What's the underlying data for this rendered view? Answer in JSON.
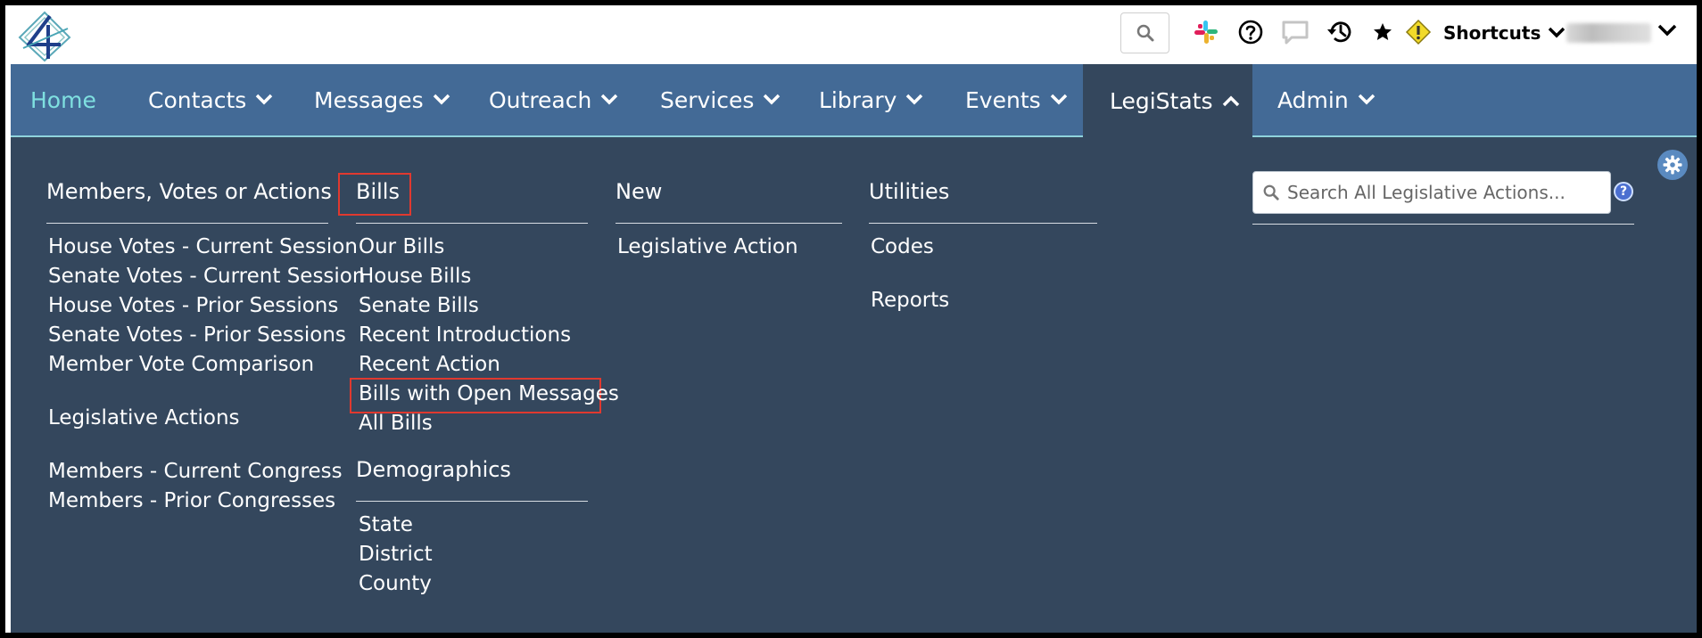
{
  "topbar": {
    "shortcuts_label": "Shortcuts",
    "icons": [
      "search-icon",
      "slack-icon",
      "help-icon",
      "chat-icon",
      "history-icon",
      "star-icon",
      "warning-icon"
    ],
    "colors": {
      "warning": "#e8d21c",
      "slack_red": "#e01e5a",
      "slack_green": "#2eb67d",
      "slack_blue": "#36c5f0",
      "slack_yellow": "#ecb22e"
    }
  },
  "nav": {
    "background": "#436a96",
    "active_background": "#34475d",
    "home_color": "#7fe0e0",
    "items": [
      {
        "label": "Home"
      },
      {
        "label": "Contacts"
      },
      {
        "label": "Messages"
      },
      {
        "label": "Outreach"
      },
      {
        "label": "Services"
      },
      {
        "label": "Library"
      },
      {
        "label": "Events"
      },
      {
        "label": "LegiStats"
      },
      {
        "label": "Admin"
      }
    ]
  },
  "menu": {
    "members": {
      "heading": "Members, Votes or Actions",
      "links": [
        "House Votes - Current Session",
        "Senate Votes - Current Session",
        "House Votes - Prior Sessions",
        "Senate Votes - Prior Sessions",
        "Member Vote Comparison",
        "Legislative Actions",
        "Members - Current Congress",
        "Members - Prior Congresses"
      ]
    },
    "bills": {
      "heading": "Bills",
      "links": [
        "Our Bills",
        "House Bills",
        "Senate Bills",
        "Recent Introductions",
        "Recent Action",
        "Bills with Open Messages",
        "All Bills"
      ]
    },
    "demographics": {
      "heading": "Demographics",
      "links": [
        "State",
        "District",
        "County"
      ]
    },
    "new": {
      "heading": "New",
      "links": [
        "Legislative Action"
      ]
    },
    "utilities": {
      "heading": "Utilities",
      "links": [
        "Codes",
        "Reports"
      ]
    },
    "search": {
      "placeholder": "Search All Legislative Actions..."
    },
    "highlight_color": "#e0392f"
  }
}
